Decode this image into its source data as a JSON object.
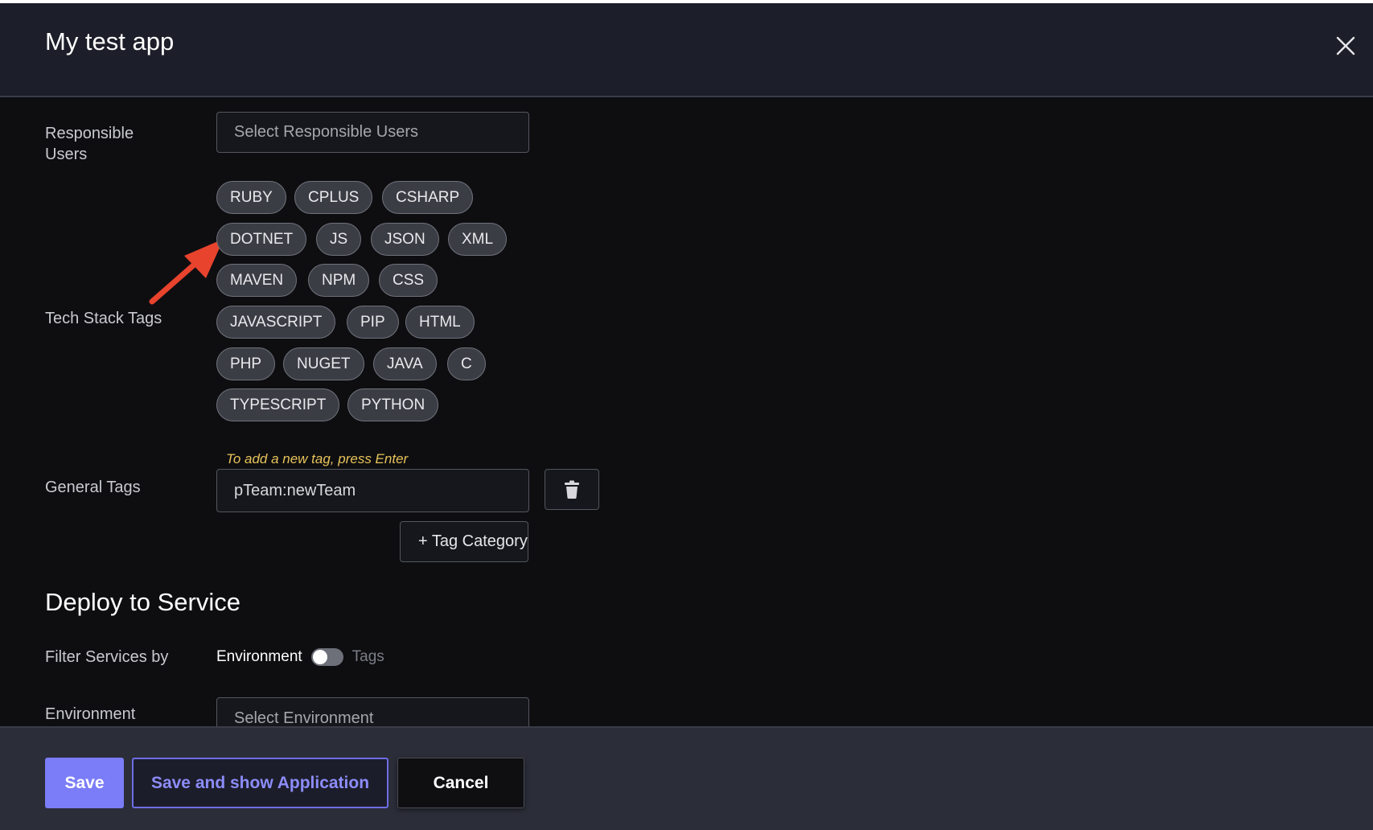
{
  "dialog": {
    "title": "My test app",
    "close_icon": "close-icon"
  },
  "form": {
    "responsible_users": {
      "label": "Responsible Users",
      "placeholder": "Select Responsible Users"
    },
    "tech_stack": {
      "label": "Tech Stack Tags",
      "tags": [
        "RUBY",
        "CPLUS",
        "CSHARP",
        "DOTNET",
        "JS",
        "JSON",
        "XML",
        "MAVEN",
        "NPM",
        "CSS",
        "JAVASCRIPT",
        "PIP",
        "HTML",
        "PHP",
        "NUGET",
        "JAVA",
        "C",
        "TYPESCRIPT",
        "PYTHON"
      ]
    },
    "general_tags": {
      "label": "General Tags",
      "hint": "To add a new tag, press Enter",
      "value": "pTeam:newTeam",
      "delete_icon": "trash-icon",
      "add_category_label": "+ Tag Category"
    }
  },
  "deploy": {
    "title": "Deploy to Service",
    "filter_label": "Filter Services by",
    "toggle_left": "Environment",
    "toggle_right": "Tags",
    "toggle_on": false,
    "environment_label": "Environment",
    "environment_placeholder": "Select Environment"
  },
  "footer": {
    "save_label": "Save",
    "save_show_label": "Save and show Application",
    "cancel_label": "Cancel"
  },
  "annotation": {
    "arrow_color": "#e8432d"
  }
}
